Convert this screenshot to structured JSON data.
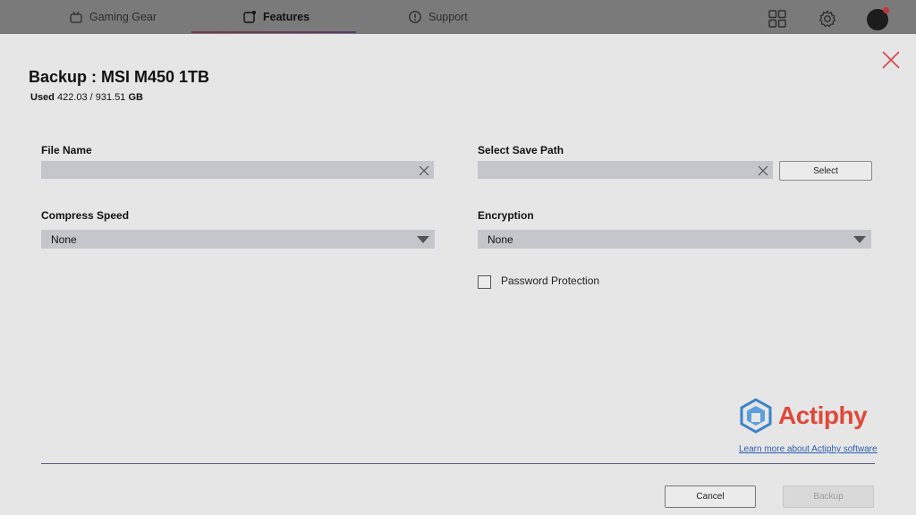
{
  "nav": {
    "tabs": [
      {
        "label": "Gaming Gear",
        "icon": "gamepad-icon"
      },
      {
        "label": "Features",
        "icon": "features-icon"
      },
      {
        "label": "Support",
        "icon": "support-icon"
      }
    ],
    "active_tab": "Features",
    "right_icons": [
      "grid-icon",
      "gear-icon",
      "avatar"
    ]
  },
  "dialog": {
    "title": "Backup : MSI M450 1TB",
    "used_label": "Used",
    "used_value": "422.03 / 931.51",
    "used_unit": "GB",
    "file_name": {
      "label": "File Name",
      "value": ""
    },
    "save_path": {
      "label": "Select Save Path",
      "value": "",
      "button": "Select"
    },
    "compress_speed": {
      "label": "Compress Speed",
      "selected": "None"
    },
    "encryption": {
      "label": "Encryption",
      "selected": "None"
    },
    "password_protection": {
      "label": "Password Protection",
      "checked": false
    },
    "brand": {
      "name": "Actiphy",
      "link": "Learn more about Actiphy software",
      "color": "#e0483a"
    },
    "buttons": {
      "cancel": "Cancel",
      "backup": "Backup"
    }
  }
}
